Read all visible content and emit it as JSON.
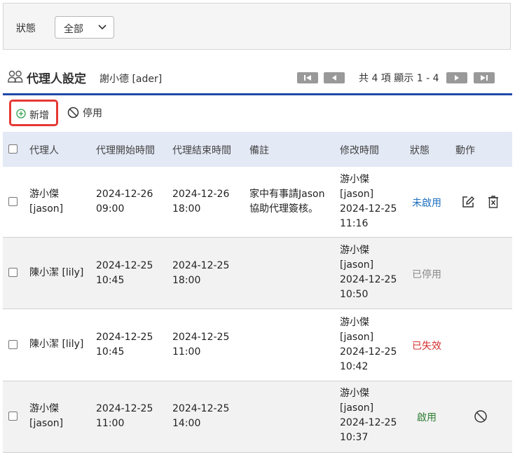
{
  "filter": {
    "label": "狀態",
    "value": "全部"
  },
  "header": {
    "title": "代理人設定",
    "user": "謝小德 [ader]",
    "page_info": "共 4 項 顯示 1 - 4"
  },
  "toolbar": {
    "add_label": "新增",
    "disable_label": "停用"
  },
  "table": {
    "headers": [
      "代理人",
      "代理開始時間",
      "代理結束時間",
      "備註",
      "修改時間",
      "狀態",
      "動作"
    ],
    "rows": [
      {
        "agent": "游小傑\n[jason]",
        "start": "2024-12-26\n09:00",
        "end": "2024-12-26\n18:00",
        "note": "家中有事請Jason\n協助代理簽核。",
        "modified": "游小傑\n[jason]\n2024-12-25\n11:16",
        "status": "未啟用",
        "status_color": "#1e6fc0",
        "actions": [
          "edit-icon",
          "delete-icon"
        ]
      },
      {
        "agent": "陳小潔 [lily]",
        "start": "2024-12-25\n10:45",
        "end": "2024-12-25\n18:00",
        "note": "",
        "modified": "游小傑\n[jason]\n2024-12-25\n10:50",
        "status": "已停用",
        "status_color": "#8a8a8a",
        "actions": []
      },
      {
        "agent": "陳小潔 [lily]",
        "start": "2024-12-25\n10:45",
        "end": "2024-12-25\n11:00",
        "note": "",
        "modified": "游小傑\n[jason]\n2024-12-25\n10:42",
        "status": "已失效",
        "status_color": "#d32f2f",
        "actions": []
      },
      {
        "agent": "游小傑\n[jason]",
        "start": "2024-12-25\n11:00",
        "end": "2024-12-25\n14:00",
        "note": "",
        "modified": "游小傑\n[jason]\n2024-12-25\n10:37",
        "status": "啟用",
        "status_color": "#2e7d32",
        "actions": [
          "disable-icon"
        ]
      }
    ]
  }
}
